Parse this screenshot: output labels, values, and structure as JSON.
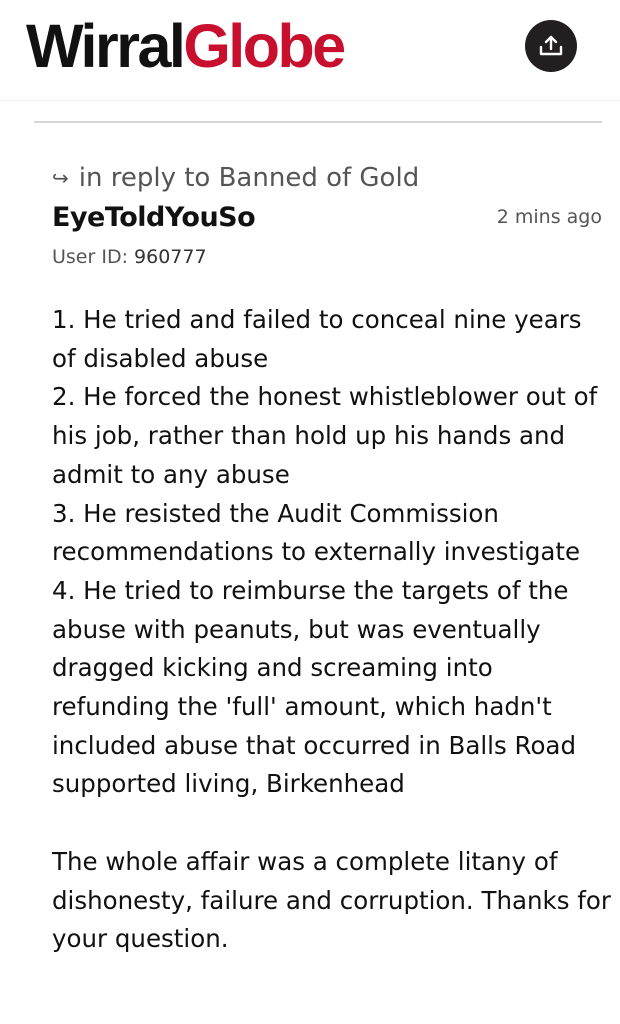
{
  "header": {
    "logo_part_1": "Wirral",
    "logo_part_2": "Globe",
    "share_icon": "share-upload-icon"
  },
  "comment": {
    "reply_icon": "↪",
    "reply_prefix": "in reply to ",
    "reply_to": "Banned of Gold",
    "username": "EyeToldYouSo",
    "timestamp": "2 mins ago",
    "user_id_label": "User ID: ",
    "user_id_value": "960777",
    "body_lines": [
      "1. He tried and failed to conceal nine years of disabled abuse",
      "2. He forced the honest whistleblower out of his job, rather than hold up his hands and admit to any abuse",
      "3. He resisted the Audit Commission recommendations to externally investigate",
      "4. He tried to reimburse the targets of the abuse with peanuts, but was eventually dragged kicking and screaming into refunding the 'full' amount, which hadn't included abuse that occurred in Balls Road supported living, Birkenhead"
    ],
    "closing": "The whole affair was a complete litany of dishonesty, failure and corruption. Thanks for your question."
  }
}
